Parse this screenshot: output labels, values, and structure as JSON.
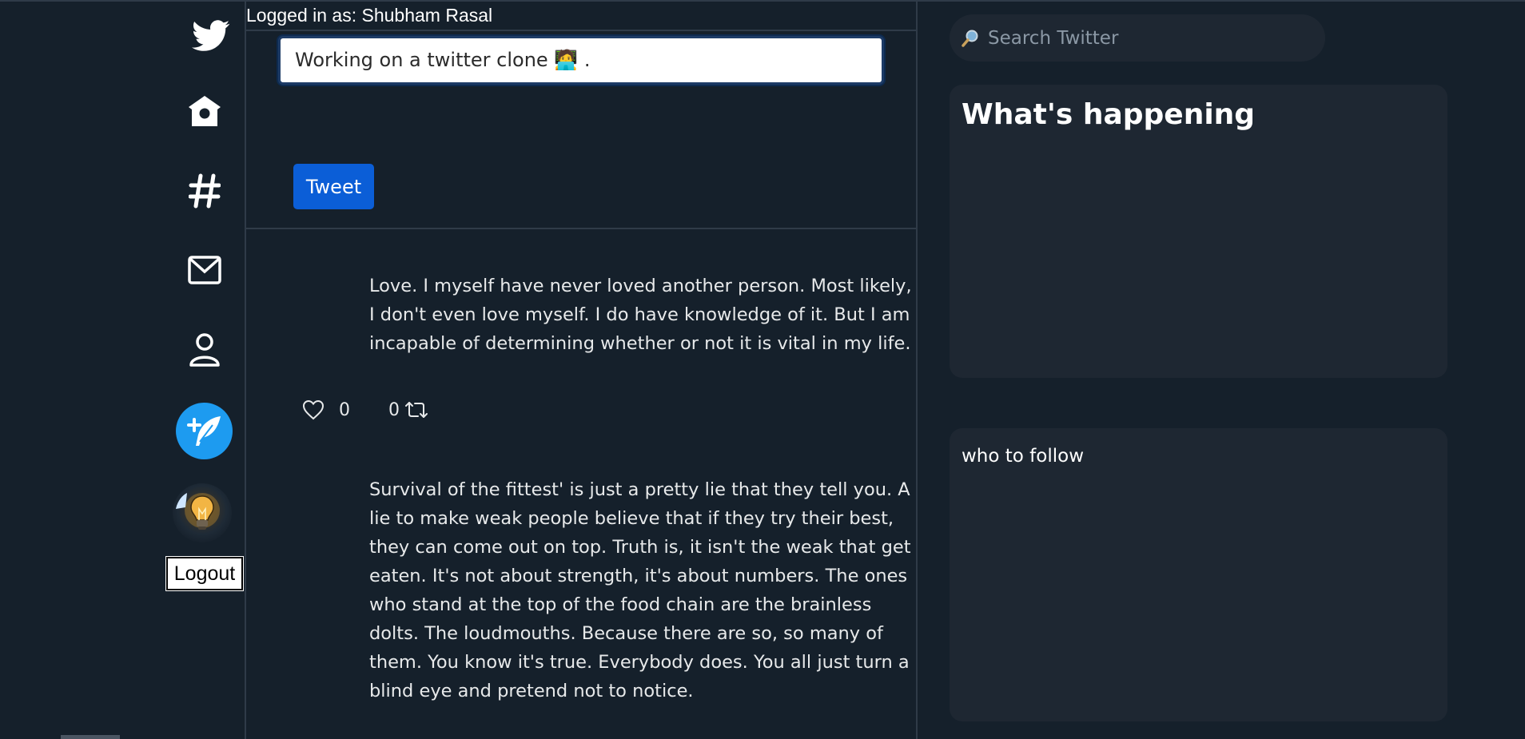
{
  "session": {
    "logged_in_text": "Logged in as: Shubham Rasal"
  },
  "nav": {
    "items": [
      "twitter-logo",
      "home-icon",
      "hashtag-icon",
      "mail-icon",
      "profile-icon"
    ],
    "logout_label": "Logout"
  },
  "composer": {
    "value": "Working on a twitter clone 🧑‍💻 .",
    "button_label": "Tweet"
  },
  "feed": {
    "posts": [
      {
        "text": "Love. I myself have never loved another person. Most likely, I don't even love myself. I do have knowledge of it. But I am incapable of determining whether or not it is vital in my life.",
        "likes": "0",
        "retweets": "0"
      },
      {
        "text": "Survival of the fittest' is just a pretty lie that they tell you. A lie to make weak people believe that if they try their best, they can come out on top. Truth is, it isn't the weak that get eaten. It's not about strength, it's about numbers. The ones who stand at the top of the food chain are the brainless dolts. The loudmouths. Because there are so, so many of them. You know it's true. Everybody does. You all just turn a blind eye and pretend not to notice."
      }
    ]
  },
  "sidebar": {
    "search_placeholder": "Search Twitter",
    "trends_title": "What's happening",
    "follow_title": "who to follow"
  },
  "colors": {
    "background": "#15202b",
    "accent": "#1d9bf0",
    "button": "#0b5ed7",
    "card": "#1e2732"
  }
}
